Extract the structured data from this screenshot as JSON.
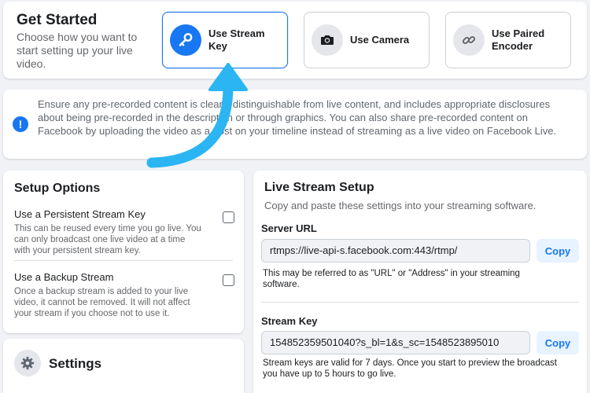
{
  "get_started": {
    "title": "Get Started",
    "subtitle": "Choose how you want to start setting up your live video.",
    "options": [
      {
        "label": "Use Stream Key",
        "icon": "key-icon",
        "selected": true
      },
      {
        "label": "Use Camera",
        "icon": "camera-icon",
        "selected": false
      },
      {
        "label": "Use Paired Encoder",
        "icon": "link-icon",
        "selected": false
      }
    ]
  },
  "notice": {
    "icon": "info-icon",
    "text": "Ensure any pre-recorded content is clearly distinguishable from live content, and includes appropriate disclosures about being pre-recorded in the description or through graphics. You can also share pre-recorded content on Facebook by uploading the video as a post on your timeline instead of streaming as a live video on Facebook Live."
  },
  "setup_options": {
    "title": "Setup Options",
    "items": [
      {
        "title": "Use a Persistent Stream Key",
        "description": "This can be reused every time you go live. You can only broadcast one live video at a time with your persistent stream key.",
        "checked": false
      },
      {
        "title": "Use a Backup Stream",
        "description": "Once a backup stream is added to your live video, it cannot be removed. It will not affect your stream if you choose not to use it.",
        "checked": false
      }
    ]
  },
  "settings": {
    "title": "Settings",
    "icon": "gear-icon"
  },
  "live_stream_setup": {
    "title": "Live Stream Setup",
    "subtitle": "Copy and paste these settings into your streaming software.",
    "server_url": {
      "label": "Server URL",
      "value": "rtmps://live-api-s.facebook.com:443/rtmp/",
      "copy_label": "Copy",
      "help": "This may be referred to as \"URL\" or \"Address\" in your streaming software."
    },
    "stream_key": {
      "label": "Stream Key",
      "value": "154852359501040?s_bl=1&s_sc=1548523895010",
      "copy_label": "Copy",
      "help": "Stream keys are valid for 7 days. Once you start to preview the broadcast you have up to 5 hours to go live."
    }
  },
  "colors": {
    "accent": "#1877f2",
    "arrow": "#2bb5f3",
    "background": "#f0f2f5"
  }
}
